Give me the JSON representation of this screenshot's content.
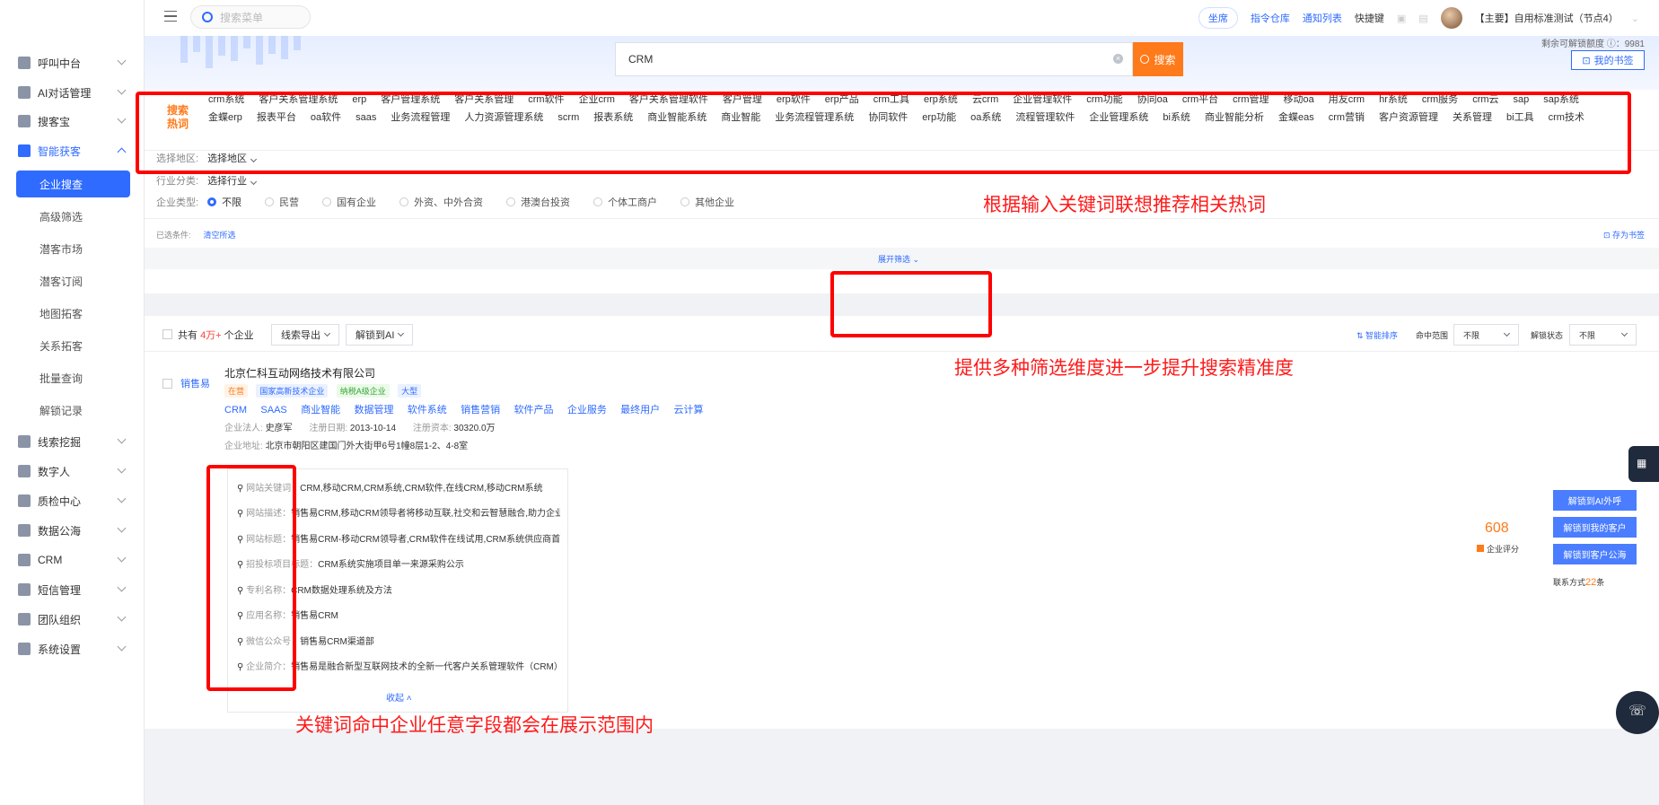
{
  "sidebar": {
    "items": [
      {
        "label": "呼叫中台"
      },
      {
        "label": "AI对话管理"
      },
      {
        "label": "搜客宝"
      },
      {
        "label": "智能获客"
      },
      {
        "label": "线索挖掘"
      },
      {
        "label": "数字人"
      },
      {
        "label": "质检中心"
      },
      {
        "label": "数据公海"
      },
      {
        "label": "CRM"
      },
      {
        "label": "短信管理"
      },
      {
        "label": "团队组织"
      },
      {
        "label": "系统设置"
      }
    ],
    "sub_items": [
      {
        "label": "企业搜查"
      },
      {
        "label": "高级筛选"
      },
      {
        "label": "潜客市场"
      },
      {
        "label": "潜客订阅"
      },
      {
        "label": "地图拓客"
      },
      {
        "label": "关系拓客"
      },
      {
        "label": "批量查询"
      },
      {
        "label": "解锁记录"
      }
    ]
  },
  "topbar": {
    "search_placeholder": "搜索菜单",
    "seat": "坐席",
    "command_store": "指令仓库",
    "notice_list": "通知列表",
    "shortcut": "快捷键",
    "user": "【主要】自用标准测试（节点4）"
  },
  "search": {
    "value": "CRM",
    "button": "搜索",
    "remaining": "剩余可解锁额度 ⓘ：9981",
    "my_tags": "我的书签"
  },
  "hot_words": {
    "logo": "搜索热词",
    "row1": [
      "crm系统",
      "客户关系管理系统",
      "erp",
      "客户管理系统",
      "客户关系管理",
      "crm软件",
      "企业crm",
      "客户关系管理软件",
      "客户管理",
      "erp软件",
      "erp产品",
      "crm工具",
      "erp系统",
      "云crm",
      "企业管理软件",
      "crm功能",
      "协同oa",
      "crm平台",
      "crm管理",
      "移动oa",
      "用友crm",
      "hr系统",
      "crm服务",
      "crm云",
      "sap",
      "sap系统"
    ],
    "row2": [
      "金蝶erp",
      "报表平台",
      "oa软件",
      "saas",
      "业务流程管理",
      "人力资源管理系统",
      "scrm",
      "报表系统",
      "商业智能系统",
      "商业智能",
      "业务流程管理系统",
      "协同软件",
      "erp功能",
      "oa系统",
      "流程管理软件",
      "企业管理系统",
      "bi系统",
      "商业智能分析",
      "金蝶eas",
      "crm营销",
      "客户资源管理",
      "关系管理",
      "bi工具",
      "crm技术"
    ]
  },
  "filters": {
    "region_label": "选择地区:",
    "region_value": "选择地区",
    "industry_label": "行业分类:",
    "industry_value": "选择行业",
    "type_label": "企业类型:",
    "types": [
      "不限",
      "民营",
      "国有企业",
      "外资、中外合资",
      "港澳台投资",
      "个体工商户",
      "其他企业"
    ],
    "selected_label": "已选条件:",
    "clear": "清空所选",
    "save_tag": "存为书签",
    "expand": "展开筛选"
  },
  "results_header": {
    "total_prefix": "共有",
    "total_count": "4万+",
    "total_suffix": "个企业",
    "export": "线索导出",
    "unlock_ai": "解锁到AI",
    "smart_sort": "智能排序",
    "hit_range_label": "命中范围",
    "hit_range_value": "不限",
    "unlock_status_label": "解锁状态",
    "unlock_status_value": "不限"
  },
  "company": {
    "logo_text": "销售易",
    "name": "北京仁科互动网络技术有限公司",
    "tags": [
      "在营",
      "国家高新技术企业",
      "纳税A级企业",
      "大型"
    ],
    "keywords": [
      "CRM",
      "SAAS",
      "商业智能",
      "数据管理",
      "软件系统",
      "销售营销",
      "软件产品",
      "企业服务",
      "最终用户",
      "云计算"
    ],
    "legal_label": "企业法人:",
    "legal_value": "史彦军",
    "reg_date_label": "注册日期:",
    "reg_date_value": "2013-10-14",
    "capital_label": "注册资本:",
    "capital_value": "30320.0万",
    "address_label": "企业地址:",
    "address_value": "北京市朝阳区建国门外大街甲6号1幢8层1-2、4-8室",
    "details": [
      {
        "label": "网站关键词：",
        "value": "CRM,移动CRM,CRM系统,CRM软件,在线CRM,移动CRM系统"
      },
      {
        "label": "网站描述：",
        "value": "销售易CRM,移动CRM领导者将移动互联,社交和云智慧融合,助力企业创建高..."
      },
      {
        "label": "网站标题：",
        "value": "销售易CRM-移动CRM领导者,CRM软件在线试用,CRM系统供应商首选"
      },
      {
        "label": "招投标项目标题：",
        "value": "CRM系统实施项目单一来源采购公示"
      },
      {
        "label": "专利名称：",
        "value": "CRM数据处理系统及方法"
      },
      {
        "label": "应用名称：",
        "value": "销售易CRM"
      },
      {
        "label": "微信公众号：",
        "value": "销售易CRM渠道部"
      },
      {
        "label": "企业简介：",
        "value": "销售易是融合新型互联网技术的全新一代客户关系管理软件（CRM） 服务..."
      }
    ],
    "collapse": "收起",
    "score": "608",
    "score_label": "企业评分",
    "btn_ai_call": "解锁到AI外呼",
    "btn_my_customers": "解锁到我的客户",
    "btn_public_pool": "解锁到客户公海",
    "contact_prefix": "联系方式",
    "contact_count": "22",
    "contact_suffix": "条"
  },
  "annotations": {
    "hot_words_note": "根据输入关键词联想推荐相关热词",
    "filter_note": "提供多种筛选维度进一步提升搜索精准度",
    "field_note": "关键词命中企业任意字段都会在展示范围内"
  },
  "colors": {
    "accent": "#2f6bff",
    "search_button": "#ff7a1a",
    "annotation": "#ff0000"
  }
}
